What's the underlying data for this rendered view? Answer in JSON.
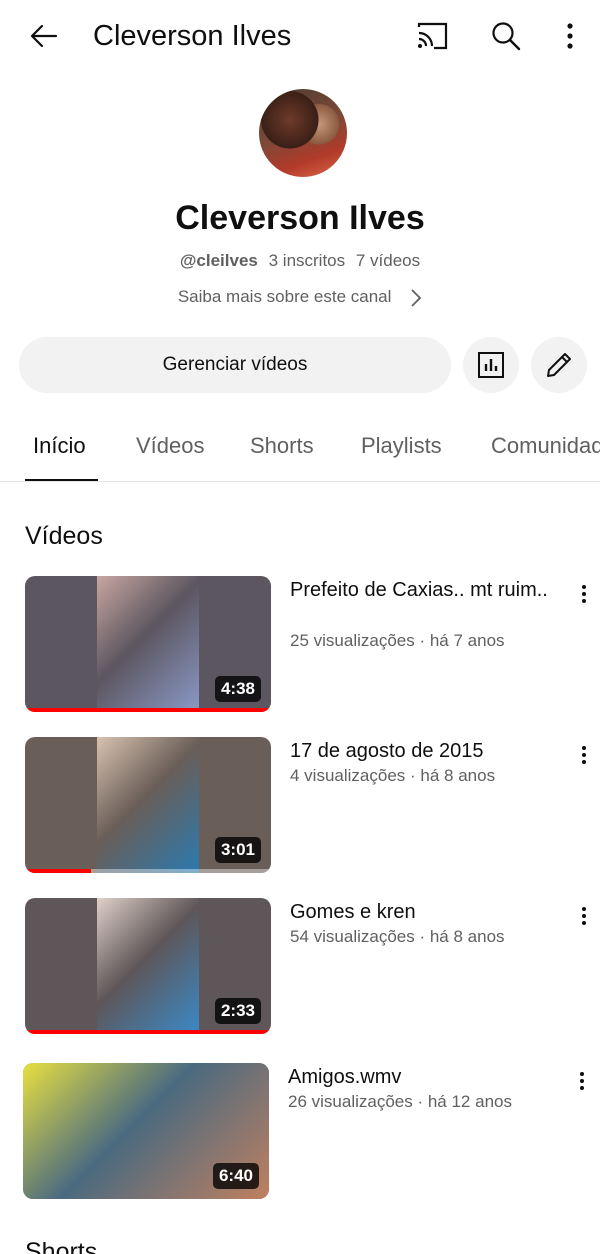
{
  "topbar": {
    "title": "Cleverson Ilves",
    "icons": [
      "arrow-left-icon",
      "cast-icon",
      "search-icon",
      "more-vert-icon"
    ]
  },
  "channel": {
    "name": "Cleverson Ilves",
    "handle": "@cleilves",
    "subscribers": "3 inscritos",
    "video_count": "7 vídeos",
    "about": "Saiba mais sobre este canal"
  },
  "actions": {
    "manage_label": "Gerenciar vídeos",
    "icons": [
      "analytics-icon",
      "edit-pencil-icon"
    ]
  },
  "tabs": [
    {
      "label": "Início",
      "active": true
    },
    {
      "label": "Vídeos",
      "active": false
    },
    {
      "label": "Shorts",
      "active": false
    },
    {
      "label": "Playlists",
      "active": false
    },
    {
      "label": "Comunidade",
      "active": false
    }
  ],
  "videos_section": {
    "title": "Vídeos",
    "items": [
      {
        "title": "Prefeito de Caxias.. mt ruim..",
        "meta": "25 visualizações · há 7 anos",
        "duration": "4:38",
        "watched_fraction": 1.0,
        "thumb_colors": [
          "#5c5660",
          "#c8a6a0",
          "#8a9ac8"
        ]
      },
      {
        "title": "17 de agosto de 2015",
        "meta": "4 visualizações · há 8 anos",
        "duration": "3:01",
        "watched_fraction": 0.27,
        "thumb_colors": [
          "#6a5e58",
          "#d8c2b0",
          "#2a7ab0"
        ]
      },
      {
        "title": "Gomes e kren",
        "meta": "54 visualizações · há 8 anos",
        "duration": "2:33",
        "watched_fraction": 1.0,
        "thumb_colors": [
          "#5e5658",
          "#e0d0c8",
          "#3a8ac8"
        ]
      },
      {
        "title": "Amigos.wmv",
        "meta": "26 visualizações · há 12 anos",
        "duration": "6:40",
        "watched_fraction": 0.0,
        "thumb_colors": [
          "#4a6a80",
          "#e8e040",
          "#c08060"
        ]
      }
    ]
  },
  "shorts_section": {
    "title": "Shorts"
  }
}
